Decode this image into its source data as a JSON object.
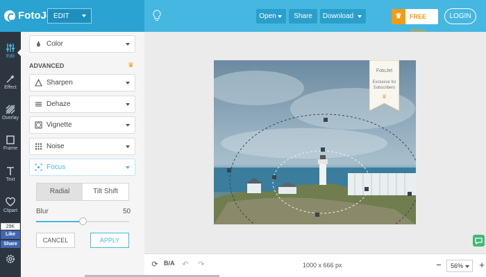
{
  "app": {
    "name": "FotoJet",
    "mode": "EDIT"
  },
  "toolbar": {
    "open_label": "Open",
    "share_label": "Share",
    "download_label": "Download",
    "trial_label": "FREE TRIAL",
    "login_label": "LOGIN"
  },
  "sidebar": {
    "items": [
      {
        "label": "Edit",
        "icon": "sliders-icon",
        "active": true
      },
      {
        "label": "Effect",
        "icon": "magic-wand-icon"
      },
      {
        "label": "Overlay",
        "icon": "stripes-icon"
      },
      {
        "label": "Frame",
        "icon": "frame-icon"
      },
      {
        "label": "Text",
        "icon": "text-icon"
      },
      {
        "label": "Clipart",
        "icon": "heart-icon"
      }
    ]
  },
  "social": {
    "count": "29K",
    "like": "Like",
    "share": "Share"
  },
  "panel": {
    "top_dropdown": "Color",
    "section_title": "ADVANCED",
    "tools": [
      "Sharpen",
      "Dehaze",
      "Vignette",
      "Noise",
      "Focus"
    ],
    "focus": {
      "modes": [
        "Radial",
        "Tilt Shift"
      ],
      "selected_mode": "Radial",
      "blur_label": "Blur",
      "blur_value": "50",
      "blur_fraction": 0.5,
      "cancel_label": "CANCEL",
      "apply_label": "APPLY"
    }
  },
  "watermark": {
    "brand": "FotoJet",
    "line1": "Exclusive for",
    "line2": "Subscribers"
  },
  "status": {
    "dimensions": "1000 x 666 px",
    "zoom": "56%"
  },
  "colors": {
    "primary": "#46b7e0",
    "sidebar_dark": "#2d3640",
    "trial_orange": "#f39c12",
    "chat_green": "#3fba74"
  }
}
